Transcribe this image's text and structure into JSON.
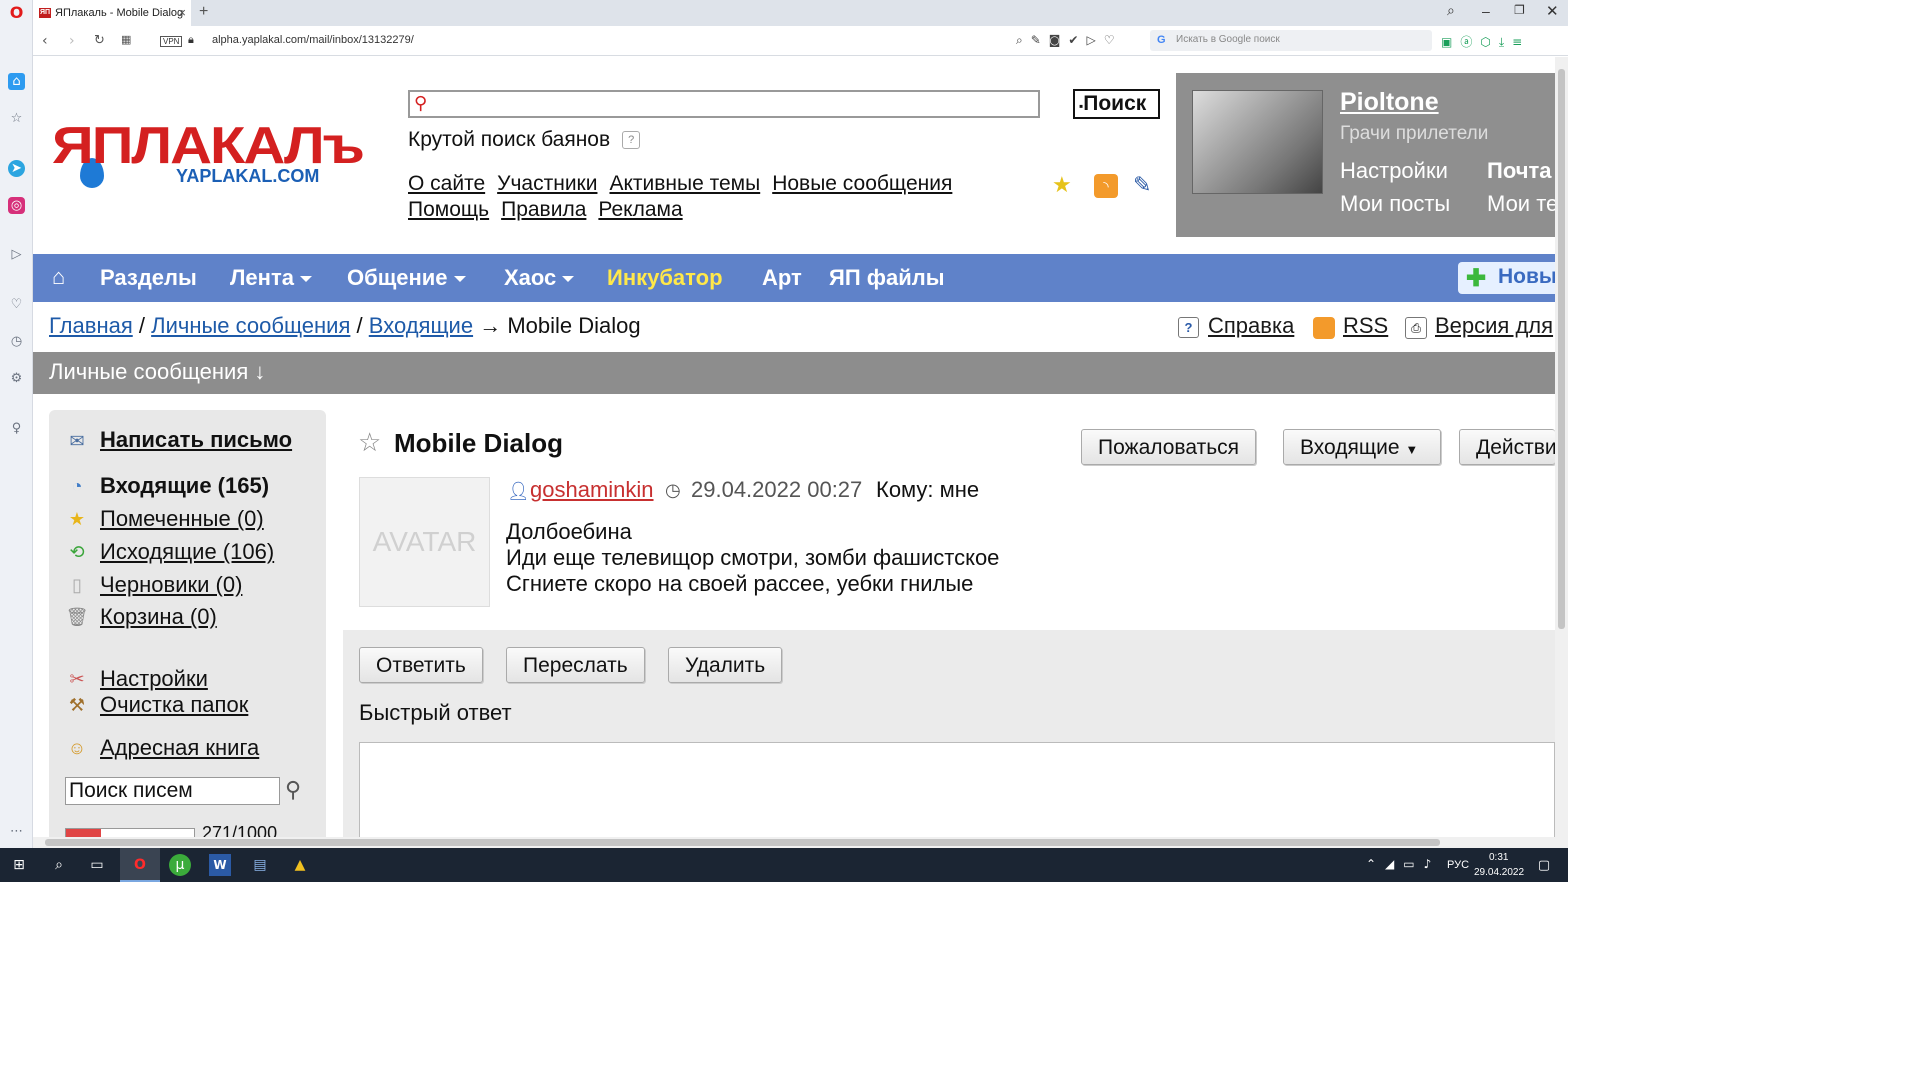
{
  "browser": {
    "tab_title": "ЯПлакаль - Mobile Dialog",
    "tab_favicon": "ЯП",
    "url": "alpha.yaplakal.com/mail/inbox/13132279/",
    "vpn_label": "VPN",
    "search_placeholder": "Искать в Google поиск"
  },
  "site": {
    "logo_main": "ЯПЛАКАЛъ",
    "logo_sub": "YAPLAKAL.COM",
    "search_button": "Поиск",
    "slogan": "Крутой поиск баянов",
    "help_mark": "?",
    "top_links_row1": [
      "О сайте",
      "Участники",
      "Активные темы",
      "Новые сообщения"
    ],
    "top_links_row2": [
      "Помощь",
      "Правила",
      "Реклама"
    ]
  },
  "user": {
    "name": "Pioltone",
    "status": "Грачи прилетели",
    "links": [
      "Настройки",
      "Почта",
      "Мои посты",
      "Мои те"
    ]
  },
  "nav": {
    "items": [
      "Разделы",
      "Лента",
      "Общение",
      "Хаос",
      "Инкубатор",
      "Арт",
      "ЯП файлы"
    ],
    "new_button": "Новы"
  },
  "breadcrumb": {
    "home": "Главная",
    "sep": "/",
    "pm": "Личные сообщения",
    "inbox": "Входящие",
    "arrow": "→",
    "current": "Mobile Dialog",
    "help": "Справка",
    "rss": "RSS",
    "version": "Версия для"
  },
  "section_title": "Личные сообщения ↓",
  "left": {
    "compose": "Написать письмо",
    "inbox": "Входящие (165)",
    "flagged": "Помеченные (0)",
    "sent": "Исходящие (106)",
    "drafts": "Черновики (0)",
    "trash": "Корзина (0)",
    "settings": "Настройки",
    "cleanup": "Очистка папок",
    "addressbook": "Адресная книга",
    "search_value": "Поиск писем",
    "quota": "271/1000"
  },
  "message": {
    "title": "Mobile Dialog",
    "report": "Пожаловаться",
    "folder": "Входящие",
    "actions": "Действи",
    "avatar": "AVATAR",
    "sender": "goshaminkin",
    "date": "29.04.2022 00:27",
    "to": "Кому: мне",
    "lines": [
      "Долбоебина",
      "Иди еще телевищор смотри, зомби фашистское",
      "Сгниете скоро на своей рассее, уебки гнилые"
    ],
    "reply": "Ответить",
    "forward": "Переслать",
    "delete": "Удалить",
    "quick_reply": "Быстрый ответ"
  },
  "taskbar": {
    "lang": "РУС",
    "time": "0:31",
    "date": "29.04.2022"
  }
}
